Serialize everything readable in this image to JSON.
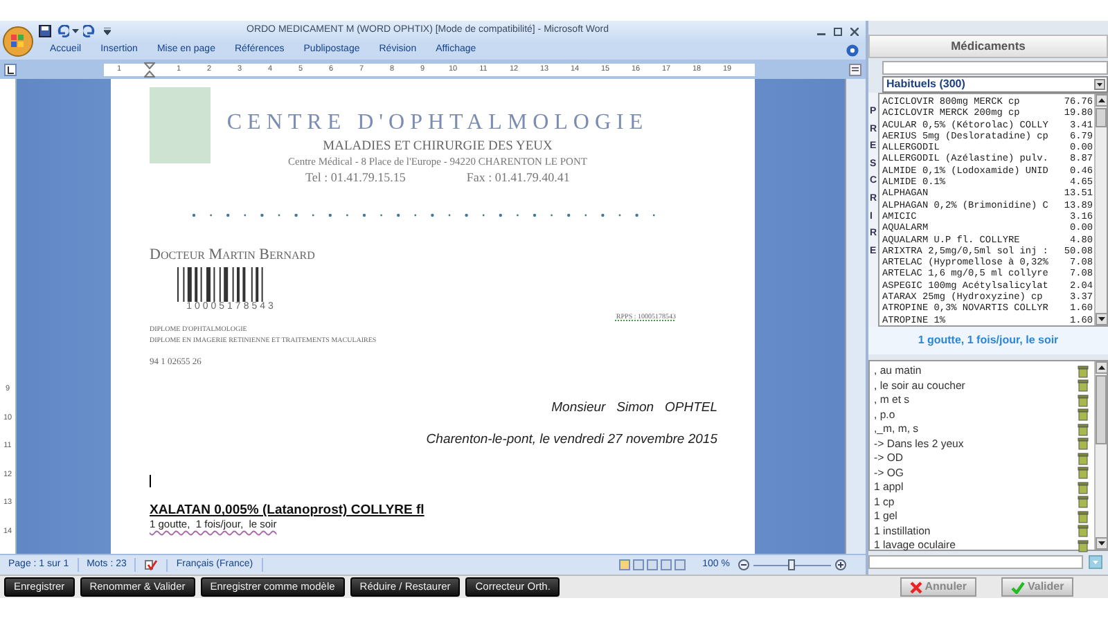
{
  "window": {
    "title": "ORDO MEDICAMENT M (WORD OPHTIX) [Mode de compatibilité] - Microsoft Word"
  },
  "ribbon_tabs": [
    "Accueil",
    "Insertion",
    "Mise en page",
    "Références",
    "Publipostage",
    "Révision",
    "Affichage"
  ],
  "ruler": {
    "horizontal": [
      "1",
      "1",
      "2",
      "3",
      "4",
      "5",
      "6",
      "7",
      "8",
      "9",
      "10",
      "11",
      "12",
      "13",
      "14",
      "15",
      "16",
      "17",
      "18",
      "19"
    ],
    "vertical": [
      "9",
      "10",
      "11",
      "12",
      "13",
      "14"
    ]
  },
  "document": {
    "clinic_name": "CENTRE D'OPHTALMOLOGIE",
    "subtitle": "MALADIES ET CHIRURGIE DES YEUX",
    "address": "Centre Médical - 8 Place de l'Europe - 94220 CHARENTON LE PONT",
    "phone": "Tel : 01.41.79.15.15",
    "fax": "Fax : 01.41.79.40.41",
    "doctor": "Docteur Martin Bernard",
    "barcode_number": "10005178543",
    "rpps": "RPPS : 10005178543",
    "diplomas": [
      "DIPLOME D'OPHTALMOLOGIE",
      "DIPLOME EN IMAGERIE RETINIENNE ET TRAITEMENTS MACULAIRES"
    ],
    "id_number": "94 1 02655 26",
    "patient": "Monsieur   Simon   OPHTEL",
    "place_date": "Charenton-le-pont, le vendredi 27 novembre 2015",
    "drug": "XALATAN 0,005% (Latanoprost) COLLYRE fl",
    "dosage": "1 goutte,  1 fois/jour,  le soir"
  },
  "status_bar": {
    "page": "Page : 1 sur 1",
    "words": "Mots : 23",
    "language": "Français (France)",
    "zoom": "100 %",
    "zoom_slider": {
      "level": 0.5
    }
  },
  "bottom_buttons": [
    "Enregistrer",
    "Renommer & Valider",
    "Enregistrer comme modèle",
    "Réduire / Restaurer",
    "Correcteur Orth."
  ],
  "medications_panel": {
    "title": "Médicaments",
    "category": "Habituels (300)",
    "side_label": "PRESCRIRE",
    "items": [
      {
        "name": "ACICLOVIR 800mg MERCK cp",
        "price": "76.76"
      },
      {
        "name": "ACICLOVIR MERCK 200mg cp",
        "price": "19.80"
      },
      {
        "name": "ACULAR 0,5% (Kétorolac) COLLY",
        "price": "3.41"
      },
      {
        "name": "AERIUS 5mg (Desloratadine) cp",
        "price": "6.79"
      },
      {
        "name": "ALLERGODIL",
        "price": "0.00"
      },
      {
        "name": "ALLERGODIL (Azélastine) pulv.",
        "price": "8.87"
      },
      {
        "name": "ALMIDE 0,1% (Lodoxamide) UNID",
        "price": "0.46"
      },
      {
        "name": "ALMIDE 0.1%",
        "price": "4.65"
      },
      {
        "name": "ALPHAGAN",
        "price": "13.51"
      },
      {
        "name": "ALPHAGAN 0,2% (Brimonidine) C",
        "price": "13.89"
      },
      {
        "name": "AMICIC",
        "price": "3.16"
      },
      {
        "name": "AQUALARM",
        "price": "0.00"
      },
      {
        "name": "AQUALARM U.P fl. COLLYRE",
        "price": "4.80"
      },
      {
        "name": "ARIXTRA 2,5mg/0,5ml sol inj :",
        "price": "50.08"
      },
      {
        "name": "ARTELAC (Hypromellose à 0,32%",
        "price": "7.08"
      },
      {
        "name": "ARTELAC 1,6 mg/0,5 ml collyre",
        "price": "7.08"
      },
      {
        "name": "ASPEGIC 100mg Acétylsalicylat",
        "price": "2.04"
      },
      {
        "name": "ATARAX 25mg (Hydroxyzine) cp",
        "price": "3.37"
      },
      {
        "name": "ATROPINE 0,3% NOVARTIS COLLYR",
        "price": "1.60"
      },
      {
        "name": "ATROPINE 1%",
        "price": "1.60"
      }
    ],
    "selected_dosage": "1 goutte, 1 fois/jour, le soir",
    "phrases": [
      ", au matin",
      ", le soir au coucher",
      ", m et s",
      ", p.o",
      ",_m, m, s",
      "-> Dans les 2 yeux",
      "-> OD",
      "-> OG",
      "1 appl",
      "1 cp",
      "1 gel",
      "1 instillation",
      "1 lavage oculaire"
    ],
    "actions": [
      {
        "label": "Annuler",
        "kind": "cancel"
      },
      {
        "label": "Valider",
        "kind": "confirm"
      }
    ]
  }
}
